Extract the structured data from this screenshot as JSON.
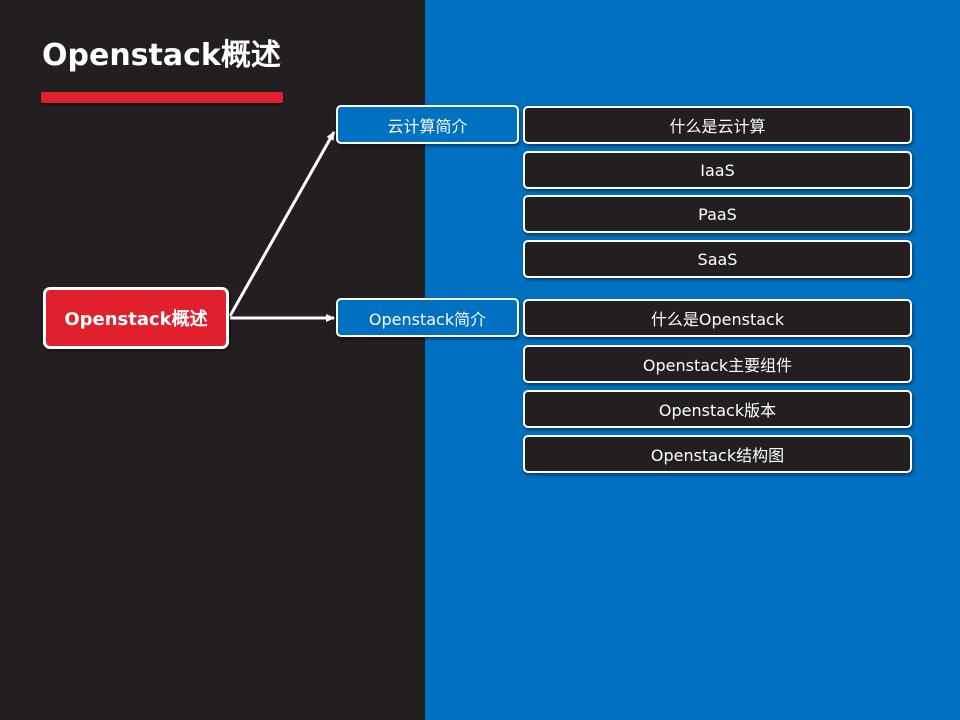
{
  "slide": {
    "title": "Openstack概述",
    "colors": {
      "left_panel": "#231f20",
      "right_panel": "#0070c0",
      "accent": "#e1202e"
    }
  },
  "diagram": {
    "root": {
      "label": "Openstack概述"
    },
    "branches": [
      {
        "label": "云计算简介",
        "children": [
          "什么是云计算",
          "IaaS",
          "PaaS",
          "SaaS"
        ]
      },
      {
        "label": "Openstack简介",
        "children": [
          "什么是Openstack",
          "Openstack主要组件",
          "Openstack版本",
          "Openstack结构图"
        ]
      }
    ]
  }
}
